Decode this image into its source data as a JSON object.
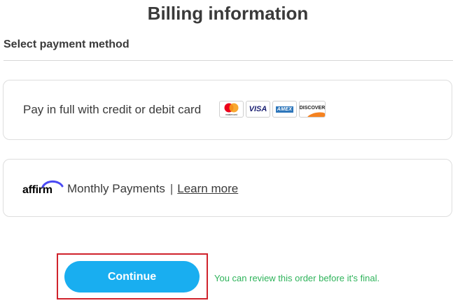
{
  "page": {
    "title": "Billing information",
    "section_label": "Select payment method"
  },
  "payment_options": {
    "card": {
      "label": "Pay in full with credit or debit card",
      "logos": [
        {
          "name": "mastercard",
          "text": "mastercard"
        },
        {
          "name": "visa",
          "text": "VISA"
        },
        {
          "name": "amex",
          "text": "AMEX"
        },
        {
          "name": "discover",
          "text": "DISCOVER"
        }
      ]
    },
    "affirm": {
      "brand": "affirm",
      "label": "Monthly Payments",
      "separator": "|",
      "learn_more": "Learn more"
    }
  },
  "footer": {
    "continue_label": "Continue",
    "review_note": "You can review this order before it's final."
  },
  "colors": {
    "continue_bg": "#19aef0",
    "review_note": "#2eb35a",
    "highlight_border": "#d0232c",
    "affirm_arc": "#4a4af4"
  }
}
